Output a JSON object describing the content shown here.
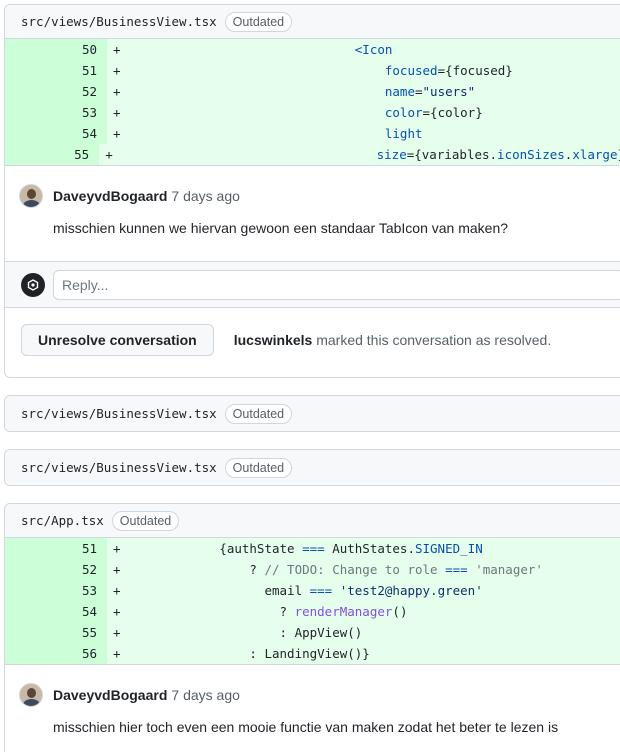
{
  "thread1": {
    "file_path": "src/views/BusinessView.tsx",
    "badge": "Outdated",
    "lines": [
      {
        "num": "50",
        "sign": "+",
        "code": "                              <Icon"
      },
      {
        "num": "51",
        "sign": "+",
        "code": "                                  focused={focused}"
      },
      {
        "num": "52",
        "sign": "+",
        "code": "                                  name=\"users\""
      },
      {
        "num": "53",
        "sign": "+",
        "code": "                                  color={color}"
      },
      {
        "num": "54",
        "sign": "+",
        "code": "                                  light"
      },
      {
        "num": "55",
        "sign": "+",
        "code": "                                  size={variables.iconSizes.xlarge}"
      }
    ],
    "comment": {
      "author": "DaveyvdBogaard",
      "time": "7 days ago",
      "body": "misschien kunnen we hiervan gewoon een standaar TabIcon van maken?"
    },
    "reply_placeholder": "Reply...",
    "unresolve_label": "Unresolve conversation",
    "resolved_user": "lucswinkels",
    "resolved_text": " marked this conversation as resolved."
  },
  "collapsed1": {
    "file_path": "src/views/BusinessView.tsx",
    "badge": "Outdated"
  },
  "collapsed2": {
    "file_path": "src/views/BusinessView.tsx",
    "badge": "Outdated"
  },
  "thread2": {
    "file_path": "src/App.tsx",
    "badge": "Outdated",
    "lines": [
      {
        "num": "51",
        "sign": "+",
        "code": "            {authState === AuthStates.SIGNED_IN"
      },
      {
        "num": "52",
        "sign": "+",
        "code": "                ? // TODO: Change to role === 'manager'"
      },
      {
        "num": "53",
        "sign": "+",
        "code": "                  email === 'test2@happy.green'"
      },
      {
        "num": "54",
        "sign": "+",
        "code": "                    ? renderManager()"
      },
      {
        "num": "55",
        "sign": "+",
        "code": "                    : AppView()"
      },
      {
        "num": "56",
        "sign": "+",
        "code": "                : LandingView()}"
      }
    ],
    "comment": {
      "author": "DaveyvdBogaard",
      "time": "7 days ago",
      "body": "misschien hier toch even een mooie functie van maken zodat het beter te lezen is"
    }
  },
  "colors": {
    "addition_bg": "#e6ffec",
    "addition_gutter": "#ccffd8",
    "border": "#d0d7de",
    "header_bg": "#f6f8fa"
  }
}
